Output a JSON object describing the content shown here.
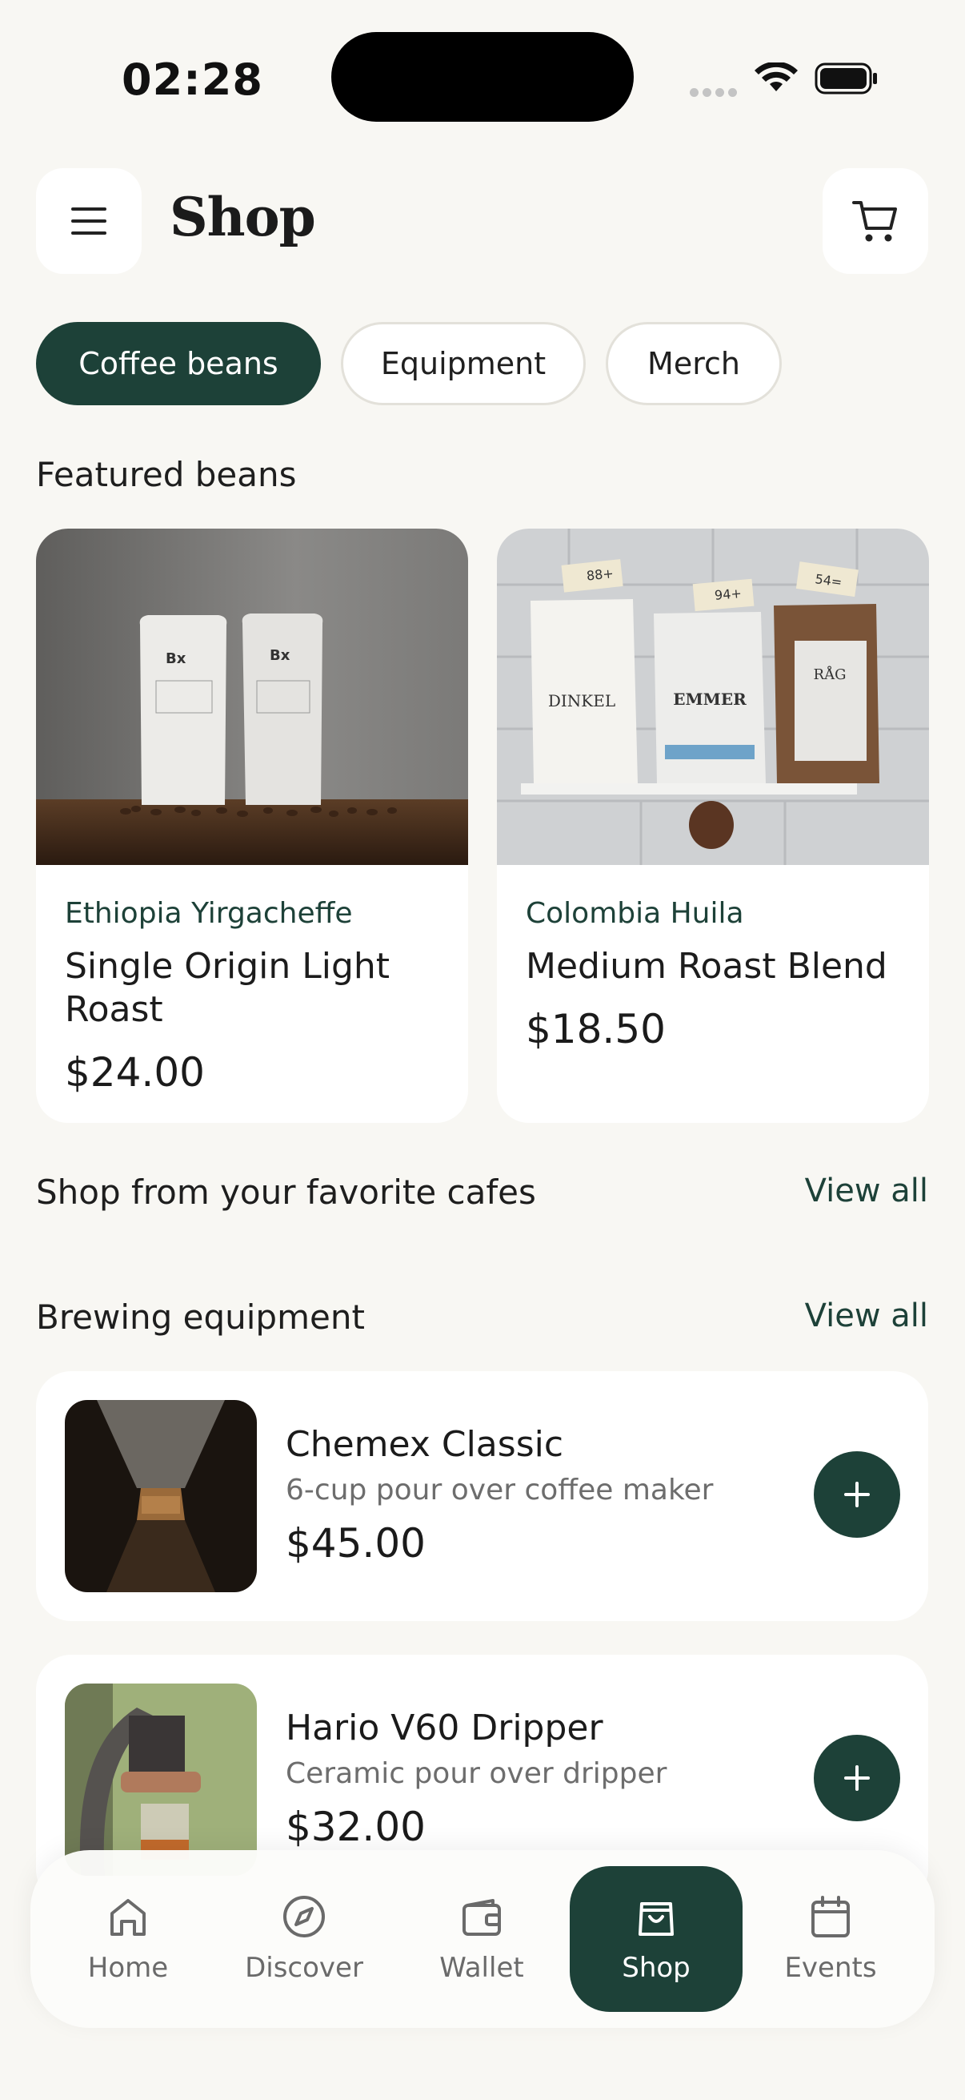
{
  "status_bar": {
    "time": "02:28"
  },
  "header": {
    "title": "Shop"
  },
  "tabs": [
    {
      "label": "Coffee beans",
      "active": true
    },
    {
      "label": "Equipment",
      "active": false
    },
    {
      "label": "Merch",
      "active": false
    }
  ],
  "featured": {
    "title": "Featured beans",
    "items": [
      {
        "origin": "Ethiopia Yirgacheffe",
        "name": "Single Origin Light Roast",
        "price": "$24.00"
      },
      {
        "origin": "Colombia Huila",
        "name": "Medium Roast Blend",
        "price": "$18.50",
        "bag_labels": [
          "DINKEL",
          "EMMER",
          "RÅG"
        ],
        "tags": [
          "88+",
          "94+",
          "54="
        ]
      }
    ]
  },
  "cafes": {
    "title": "Shop from your favorite cafes",
    "view_all": "View all"
  },
  "equipment": {
    "title": "Brewing equipment",
    "view_all": "View all",
    "items": [
      {
        "name": "Chemex Classic",
        "description": "6-cup pour over coffee maker",
        "price": "$45.00"
      },
      {
        "name": "Hario V60 Dripper",
        "description": "Ceramic pour over dripper",
        "price": "$32.00"
      }
    ]
  },
  "bottom_nav": [
    {
      "label": "Home",
      "icon": "home-icon",
      "active": false
    },
    {
      "label": "Discover",
      "icon": "compass-icon",
      "active": false
    },
    {
      "label": "Wallet",
      "icon": "wallet-icon",
      "active": false
    },
    {
      "label": "Shop",
      "icon": "shopping-bag-icon",
      "active": true
    },
    {
      "label": "Events",
      "icon": "calendar-icon",
      "active": false
    }
  ],
  "colors": {
    "accent": "#1d4138",
    "background": "#f8f7f3",
    "card": "#ffffff"
  }
}
